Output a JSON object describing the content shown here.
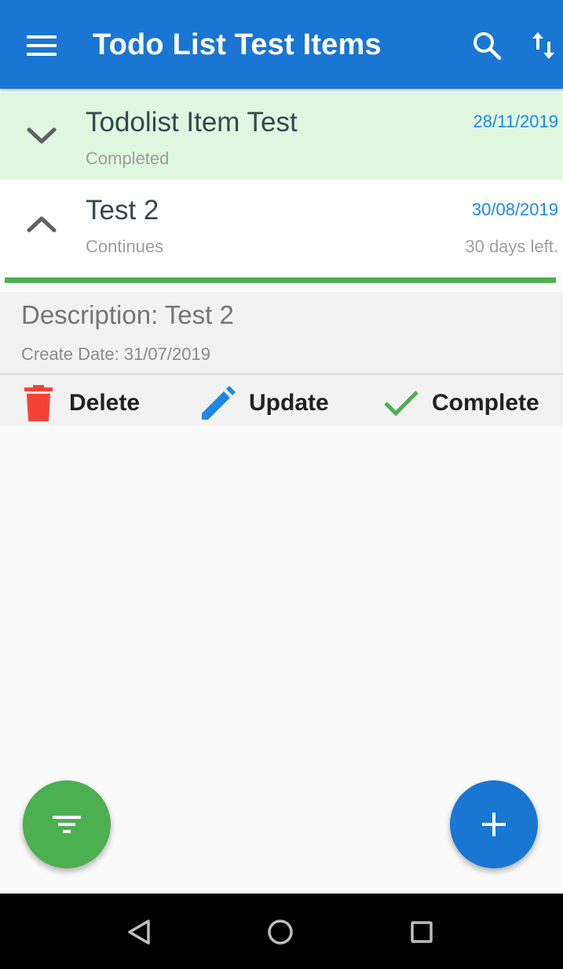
{
  "appbar": {
    "title": "Todo List Test Items",
    "icons": [
      "menu-icon",
      "search-icon",
      "sort-icon"
    ]
  },
  "items": [
    {
      "title": "Todolist Item Test",
      "status": "Completed",
      "date": "28/11/2019",
      "days_left": "",
      "expanded": false,
      "background": "#dff8df"
    },
    {
      "title": "Test 2",
      "status": "Continues",
      "date": "30/08/2019",
      "days_left": "30 days left.",
      "expanded": true,
      "background": "#ffffff",
      "progress": 1.0
    }
  ],
  "details": {
    "description": "Description: Test 2",
    "create_date": "Create Date: 31/07/2019"
  },
  "actions": {
    "delete_label": "Delete",
    "update_label": "Update",
    "complete_label": "Complete"
  },
  "fabs": [
    "filter-icon",
    "add-icon"
  ],
  "colors": {
    "primary": "#1976d2",
    "success": "#4caf50",
    "danger": "#f44336",
    "date_blue": "#1e88e5",
    "completed_bg": "#dff8df"
  }
}
